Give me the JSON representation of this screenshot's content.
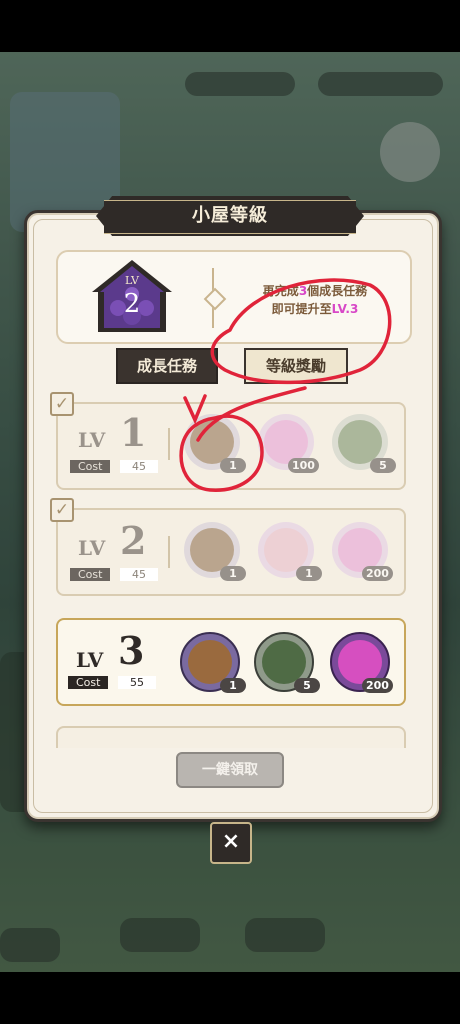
{
  "dialog": {
    "title": "小屋等級",
    "current_level": {
      "lv_prefix": "LV",
      "value": "2"
    },
    "progress_text_1_a": "再完成",
    "progress_text_1_b": "3",
    "progress_text_1_c": "個成長任務",
    "progress_text_2_a": "即可提升至",
    "progress_text_2_b": "LV.3",
    "tabs": [
      {
        "label": "成長任務",
        "selected": true
      },
      {
        "label": "等級獎勵",
        "selected": false
      }
    ],
    "levels": [
      {
        "lv": "LV",
        "num": "1",
        "cost_label": "Cost",
        "cost_value": "45",
        "claimed": true,
        "items": [
          {
            "icon": "luggage-icon",
            "count": "1"
          },
          {
            "icon": "heart-crystal-icon",
            "count": "100"
          },
          {
            "icon": "green-chest-icon",
            "count": "5"
          }
        ]
      },
      {
        "lv": "LV",
        "num": "2",
        "cost_label": "Cost",
        "cost_value": "45",
        "claimed": true,
        "items": [
          {
            "icon": "luggage-icon",
            "count": "1"
          },
          {
            "icon": "book-icon",
            "count": "1"
          },
          {
            "icon": "heart-crystal-icon",
            "count": "200"
          }
        ]
      },
      {
        "lv": "LV",
        "num": "3",
        "cost_label": "Cost",
        "cost_value": "55",
        "claimed": false,
        "items": [
          {
            "icon": "luggage-icon",
            "count": "1"
          },
          {
            "icon": "green-chest-icon",
            "count": "5"
          },
          {
            "icon": "heart-crystal-icon",
            "count": "200"
          }
        ]
      }
    ],
    "claim_all_label": "一鍵領取",
    "close_label": "×"
  },
  "colors": {
    "accent_pink": "#d848c7",
    "annotation_red": "#e0243a",
    "panel_bg": "#f6f1e7",
    "dark": "#2f2a27"
  }
}
